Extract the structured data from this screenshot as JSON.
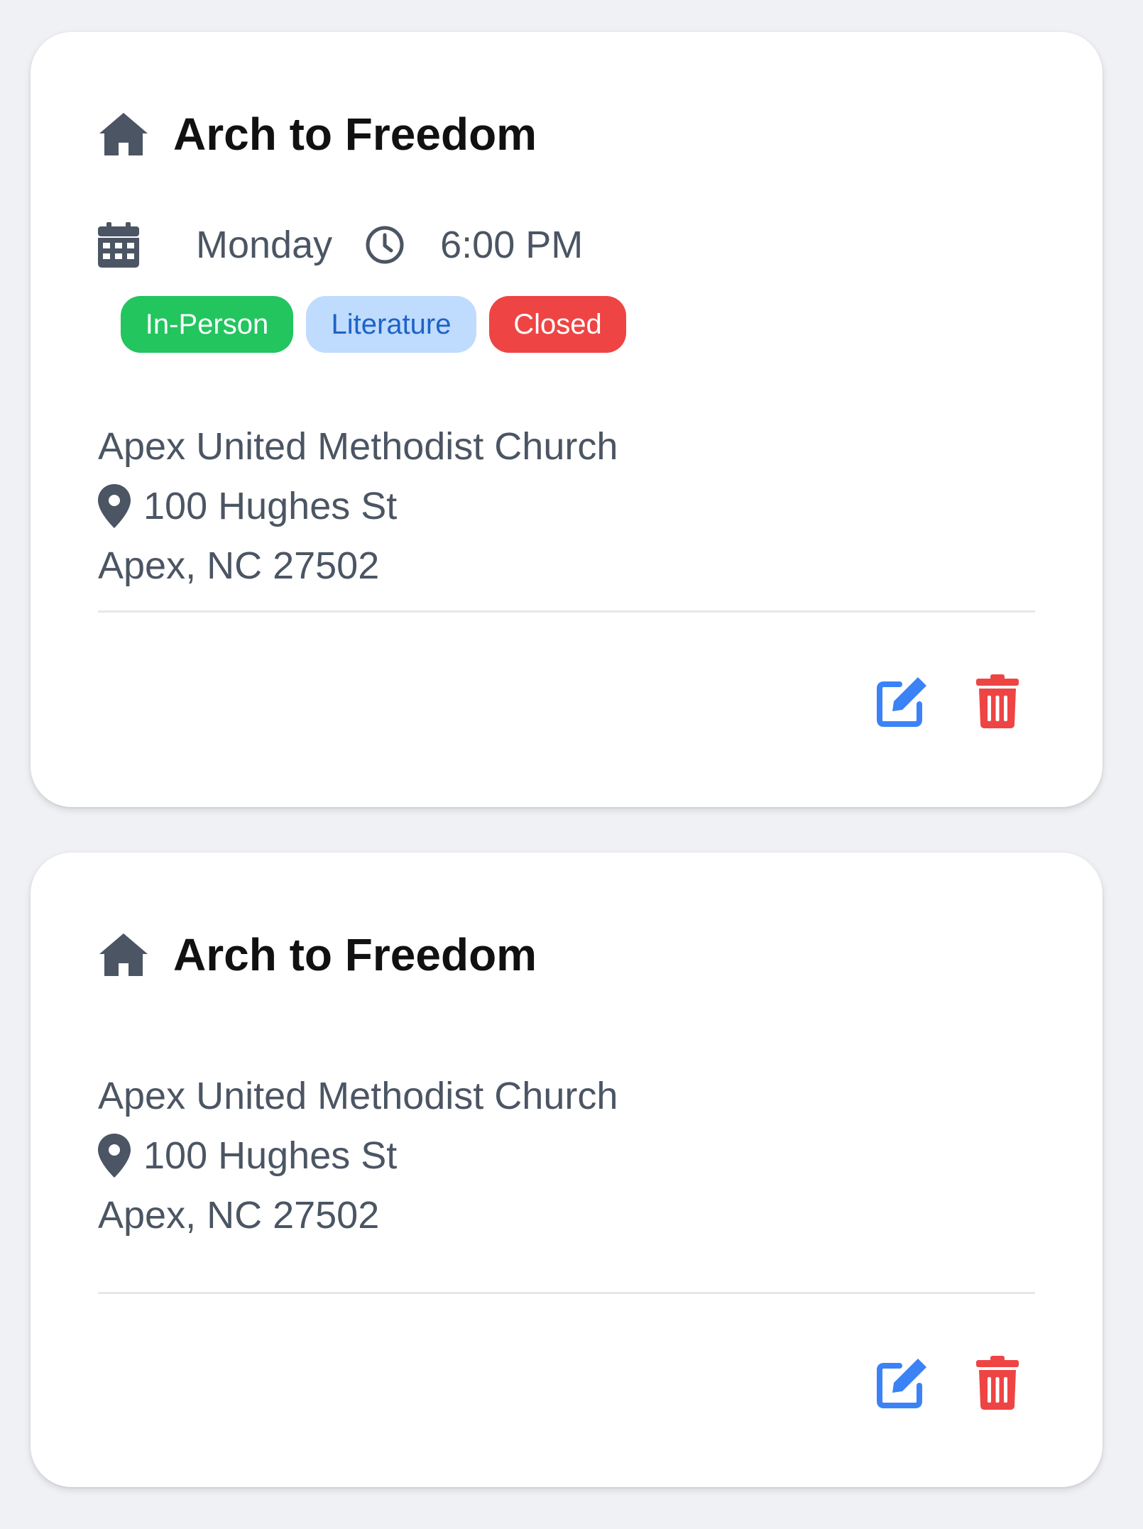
{
  "meetings": [
    {
      "name": "Arch to Freedom",
      "day": "Monday",
      "time": "6:00 PM",
      "tags": [
        {
          "label": "In-Person",
          "color": "#22c55e"
        },
        {
          "label": "Literature",
          "color": "#bfdbfe"
        },
        {
          "label": "Closed",
          "color": "#ef4444"
        }
      ],
      "location": "Apex United Methodist Church",
      "street": "100 Hughes St",
      "city_state_zip": "Apex, NC 27502",
      "actions": {
        "edit_icon": "edit-icon",
        "delete_icon": "trash-icon"
      }
    },
    {
      "name": "Arch to Freedom",
      "location": "Apex United Methodist Church",
      "street": "100 Hughes St",
      "city_state_zip": "Apex, NC 27502",
      "actions": {
        "edit_icon": "edit-icon",
        "delete_icon": "trash-icon"
      }
    }
  ],
  "colors": {
    "background": "#eff1f5",
    "edit": "#3b82f6",
    "delete": "#ef4444",
    "icon_gray": "#4b5563"
  }
}
